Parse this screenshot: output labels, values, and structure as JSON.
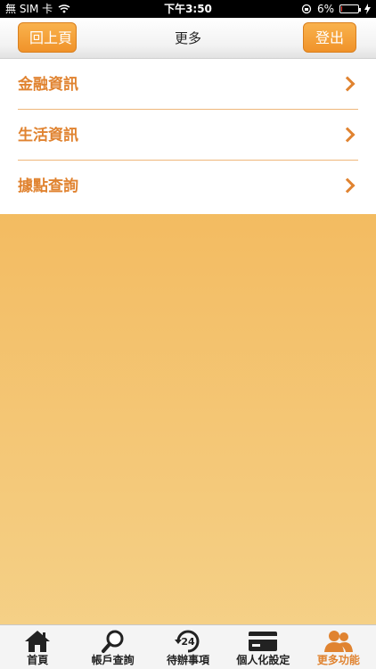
{
  "status_bar": {
    "carrier": "無 SIM 卡",
    "time": "下午3:50",
    "battery": "6%",
    "battery_level": 0.06
  },
  "nav": {
    "back_label": "回上頁",
    "title": "更多",
    "logout_label": "登出"
  },
  "menu": {
    "items": [
      {
        "label": "金融資訊"
      },
      {
        "label": "生活資訊"
      },
      {
        "label": "據點查詢"
      }
    ]
  },
  "tabs": [
    {
      "label": "首頁",
      "icon": "home-icon"
    },
    {
      "label": "帳戶查詢",
      "icon": "magnifier-icon"
    },
    {
      "label": "待辦事項",
      "icon": "24-hour-icon"
    },
    {
      "label": "個人化設定",
      "icon": "card-icon"
    },
    {
      "label": "更多功能",
      "icon": "people-icon",
      "active": true
    }
  ],
  "colors": {
    "accent": "#e08330",
    "button": "#f0932a",
    "background_top": "#f2b04a",
    "background_bottom": "#f5d28a"
  }
}
